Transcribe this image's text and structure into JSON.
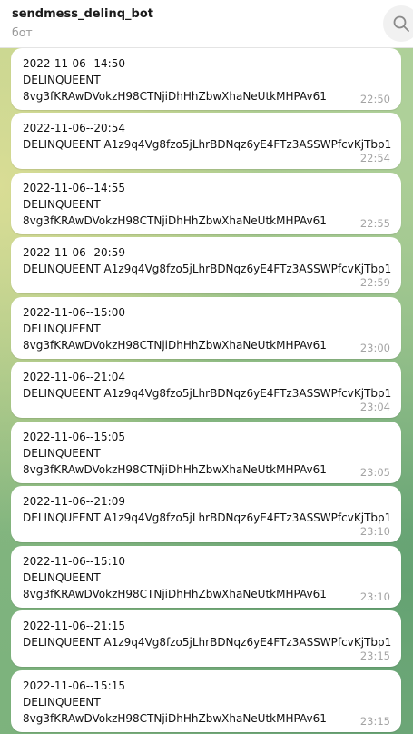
{
  "header": {
    "title": "sendmess_delinq_bot",
    "subtitle": "бот",
    "search_icon": "search-icon"
  },
  "messages": [
    {
      "date": "2022-11-06--14:50",
      "line2": "DELINQUEENT",
      "line3": "8vg3fKRAwDVokzH98CTNjiDhHhZbwXhaNeUtkMHPAv61",
      "time": "22:50"
    },
    {
      "date": "2022-11-06--20:54",
      "line2": "DELINQUEENT A1z9q4Vg8fzo5jLhrBDNqz6yE4FTz3ASSWPfcvKjTbp1",
      "time": "22:54"
    },
    {
      "date": "2022-11-06--14:55",
      "line2": "DELINQUEENT",
      "line3": "8vg3fKRAwDVokzH98CTNjiDhHhZbwXhaNeUtkMHPAv61",
      "time": "22:55"
    },
    {
      "date": "2022-11-06--20:59",
      "line2": "DELINQUEENT A1z9q4Vg8fzo5jLhrBDNqz6yE4FTz3ASSWPfcvKjTbp1",
      "time": "22:59"
    },
    {
      "date": "2022-11-06--15:00",
      "line2": "DELINQUEENT",
      "line3": "8vg3fKRAwDVokzH98CTNjiDhHhZbwXhaNeUtkMHPAv61",
      "time": "23:00"
    },
    {
      "date": "2022-11-06--21:04",
      "line2": "DELINQUEENT A1z9q4Vg8fzo5jLhrBDNqz6yE4FTz3ASSWPfcvKjTbp1",
      "time": "23:04"
    },
    {
      "date": "2022-11-06--15:05",
      "line2": "DELINQUEENT",
      "line3": "8vg3fKRAwDVokzH98CTNjiDhHhZbwXhaNeUtkMHPAv61",
      "time": "23:05"
    },
    {
      "date": "2022-11-06--21:09",
      "line2": "DELINQUEENT A1z9q4Vg8fzo5jLhrBDNqz6yE4FTz3ASSWPfcvKjTbp1",
      "time": "23:10"
    },
    {
      "date": "2022-11-06--15:10",
      "line2": "DELINQUEENT",
      "line3": "8vg3fKRAwDVokzH98CTNjiDhHhZbwXhaNeUtkMHPAv61",
      "time": "23:10"
    },
    {
      "date": "2022-11-06--21:15",
      "line2": "DELINQUEENT A1z9q4Vg8fzo5jLhrBDNqz6yE4FTz3ASSWPfcvKjTbp1",
      "time": "23:15"
    },
    {
      "date": "2022-11-06--15:15",
      "line2": "DELINQUEENT",
      "line3": "8vg3fKRAwDVokzH98CTNjiDhHhZbwXhaNeUtkMHPAv61",
      "time": "23:15"
    }
  ]
}
